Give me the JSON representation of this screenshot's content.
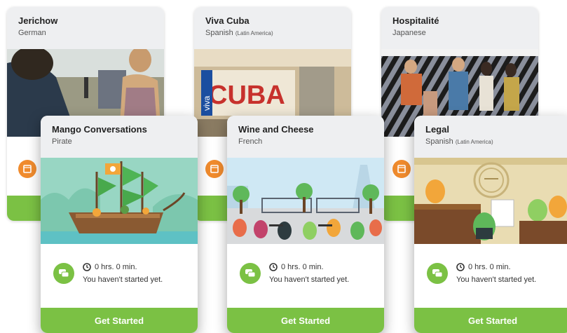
{
  "cards_back": [
    {
      "title": "Jerichow",
      "language": "German",
      "language_note": ""
    },
    {
      "title": "Viva Cuba",
      "language": "Spanish",
      "language_note": "(Latin America)"
    },
    {
      "title": "Hospitalité",
      "language": "Japanese",
      "language_note": ""
    }
  ],
  "cards_front": [
    {
      "title": "Mango Conversations",
      "language": "Pirate",
      "language_note": "",
      "time": "0 hrs. 0 min.",
      "status": "You haven't started yet.",
      "cta": "Get Started"
    },
    {
      "title": "Wine and Cheese",
      "language": "French",
      "language_note": "",
      "time": "0 hrs. 0 min.",
      "status": "You haven't started yet.",
      "cta": "Get Started"
    },
    {
      "title": "Legal",
      "language": "Spanish",
      "language_note": "(Latin America)",
      "time": "0 hrs. 0 min.",
      "status": "You haven't started yet.",
      "cta": "Get Started"
    }
  ],
  "poster_text": {
    "cuba_sign": "CUBA",
    "cuba_vertical": "viva"
  },
  "icons": {
    "clock": "clock-icon",
    "chat": "chat-bubble-icon",
    "film": "film-icon"
  },
  "colors": {
    "green": "#7bc144",
    "orange": "#f08b2d",
    "header_bg": "#eeeff1"
  }
}
